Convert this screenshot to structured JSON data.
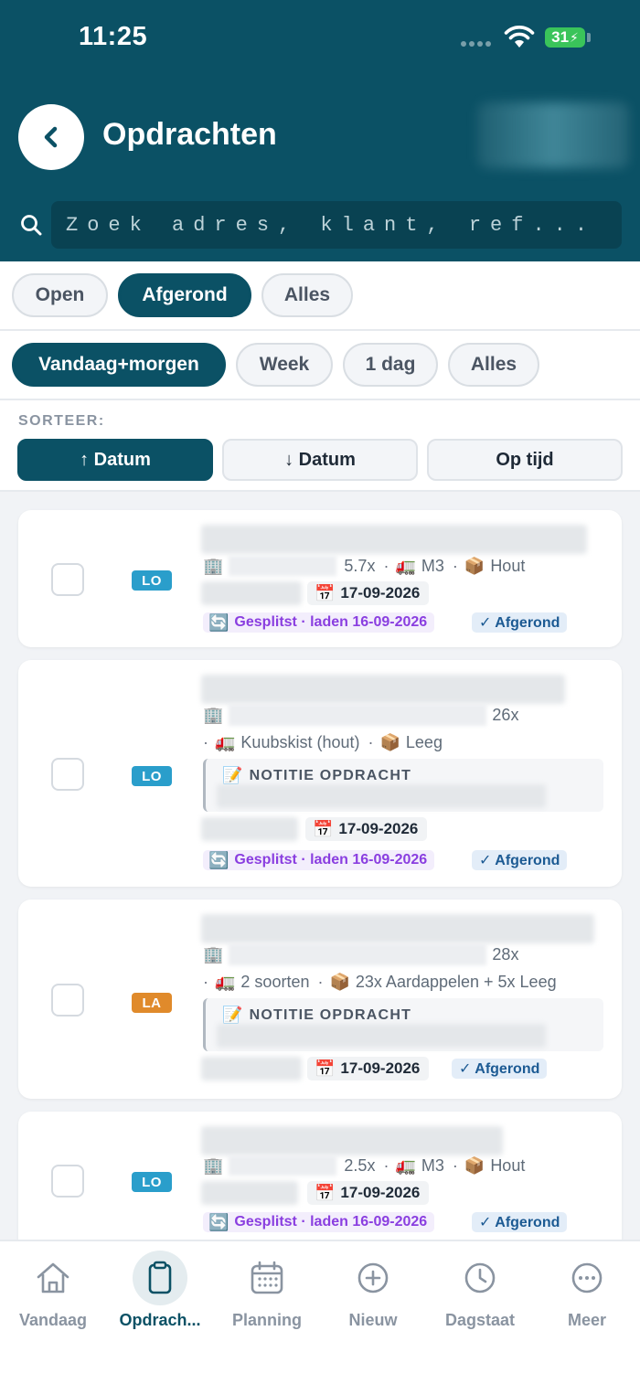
{
  "status_bar": {
    "time": "11:25",
    "battery": "31"
  },
  "header": {
    "title": "Opdrachten"
  },
  "search": {
    "placeholder": "Zoek adres, klant, ref..."
  },
  "status_filters": [
    {
      "label": "Open",
      "active": false
    },
    {
      "label": "Afgerond",
      "active": true
    },
    {
      "label": "Alles",
      "active": false
    }
  ],
  "period_filters": [
    {
      "label": "Vandaag+morgen",
      "active": true
    },
    {
      "label": "Week",
      "active": false
    },
    {
      "label": "1 dag",
      "active": false
    },
    {
      "label": "Alles",
      "active": false
    }
  ],
  "sort": {
    "label": "SORTEER:",
    "options": [
      {
        "label": "↑ Datum",
        "active": true
      },
      {
        "label": "↓ Datum",
        "active": false
      },
      {
        "label": "Op tijd",
        "active": false
      }
    ]
  },
  "orders": [
    {
      "tag": "LO",
      "count": "5.7x",
      "sep": "·",
      "vehicle": "M3",
      "cargo": "Hout",
      "date": "17-09-2026",
      "split": "Gesplitst · laden 16-09-2026",
      "status": "✓ Afgerond"
    },
    {
      "tag": "LO",
      "count": "26x",
      "sep": "·",
      "vehicle": "Kuubskist (hout)",
      "cargo": "Leeg",
      "note_title": "NOTITIE OPDRACHT",
      "date": "17-09-2026",
      "split": "Gesplitst · laden 16-09-2026",
      "status": "✓ Afgerond"
    },
    {
      "tag": "LA",
      "count": "28x",
      "sep": "·",
      "vehicle": "2 soorten",
      "cargo": "23x Aardappelen + 5x Leeg",
      "note_title": "NOTITIE OPDRACHT",
      "date": "17-09-2026",
      "status": "✓ Afgerond"
    },
    {
      "tag": "LO",
      "count": "2.5x",
      "sep": "·",
      "vehicle": "M3",
      "cargo": "Hout",
      "date": "17-09-2026",
      "split": "Gesplitst · laden 16-09-2026",
      "status": "✓ Afgerond"
    }
  ],
  "nav": [
    {
      "label": "Vandaag",
      "icon": "home-icon",
      "active": false
    },
    {
      "label": "Opdrach...",
      "icon": "clipboard-icon",
      "active": true
    },
    {
      "label": "Planning",
      "icon": "calendar-icon",
      "active": false
    },
    {
      "label": "Nieuw",
      "icon": "plus-circle-icon",
      "active": false
    },
    {
      "label": "Dagstaat",
      "icon": "clock-icon",
      "active": false
    },
    {
      "label": "Meer",
      "icon": "more-icon",
      "active": false
    }
  ],
  "colors": {
    "brand": "#0b5165",
    "tag_lo": "#2a9ecb",
    "tag_la": "#e08a2b",
    "split": "#8a3ee0",
    "done": "#1c5a93"
  }
}
